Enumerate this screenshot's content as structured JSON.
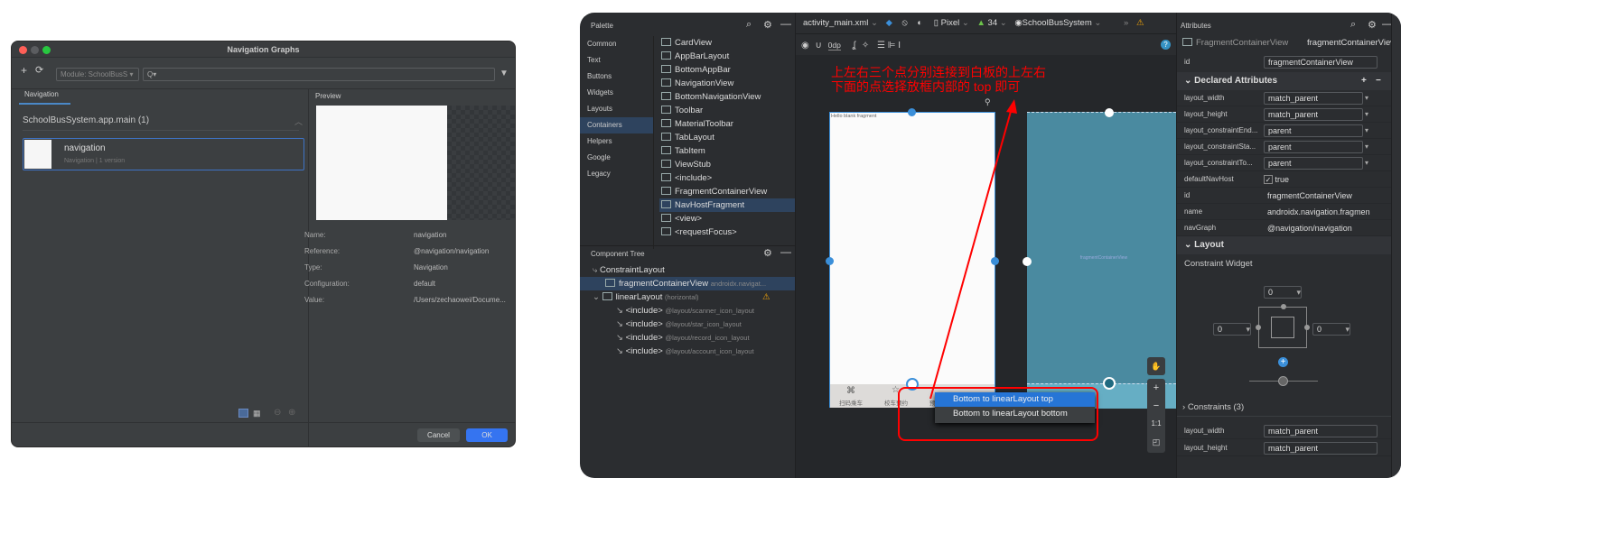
{
  "dialog": {
    "title": "Navigation Graphs",
    "module_select": "Module: SchoolBusS",
    "search_placeholder": "Q",
    "tab": "Navigation",
    "group": "SchoolBusSystem.app.main (1)",
    "item": {
      "name": "navigation",
      "meta": "Navigation  |  1 version"
    },
    "preview_label": "Preview",
    "details": [
      {
        "label": "Name:",
        "value": "navigation"
      },
      {
        "label": "Reference:",
        "value": "@navigation/navigation"
      },
      {
        "label": "Type:",
        "value": "Navigation"
      },
      {
        "label": "Configuration:",
        "value": "default"
      },
      {
        "label": "Value:",
        "value": "/Users/zechaowei/Docume..."
      }
    ],
    "cancel": "Cancel",
    "ok": "OK"
  },
  "ide": {
    "palette": {
      "title": "Palette",
      "categories": [
        "Common",
        "Text",
        "Buttons",
        "Widgets",
        "Layouts",
        "Containers",
        "Helpers",
        "Google",
        "Legacy"
      ],
      "selected_category": "Containers",
      "items": [
        "CardView",
        "AppBarLayout",
        "BottomAppBar",
        "NavigationView",
        "BottomNavigationView",
        "Toolbar",
        "MaterialToolbar",
        "TabLayout",
        "TabItem",
        "ViewStub",
        "<include>",
        "FragmentContainerView",
        "NavHostFragment",
        "<view>",
        "<requestFocus>"
      ],
      "selected_item": "NavHostFragment"
    },
    "toolbar": {
      "file": "activity_main.xml",
      "device": "Pixel",
      "api": "34",
      "theme": "SchoolBusSystem",
      "margin": "0dp"
    },
    "tree": {
      "title": "Component Tree",
      "rows": [
        {
          "name": "ConstraintLayout",
          "extra": ""
        },
        {
          "name": "fragmentContainerView",
          "extra": "androidx.navigat..."
        },
        {
          "name": "linearLayout",
          "extra": "(horizontal)"
        },
        {
          "name": "<include>",
          "extra": "@layout/scanner_icon_layout"
        },
        {
          "name": "<include>",
          "extra": "@layout/star_icon_layout"
        },
        {
          "name": "<include>",
          "extra": "@layout/record_icon_layout"
        },
        {
          "name": "<include>",
          "extra": "@layout/account_icon_layout"
        }
      ]
    },
    "annotation": {
      "line1": "上左右三个点分别连接到白板的上左右",
      "line2": "下面的点选择放框内部的 top 即可"
    },
    "design": {
      "hello": "Hello blank fragment",
      "tabs": [
        "扫码乘车",
        "校车预约",
        "预"
      ]
    },
    "blueprint": {
      "label": "fragmentContainerView"
    },
    "popup": {
      "items": [
        "Bottom to linearLayout top",
        "Bottom to linearLayout bottom"
      ],
      "selected": 0
    },
    "zoom": {
      "fit": "1:1"
    },
    "attributes": {
      "title": "Attributes",
      "class": "FragmentContainerView",
      "id_header": "fragmentContainerView",
      "id_label": "id",
      "id_value": "fragmentContainerView",
      "declared_title": "Declared Attributes",
      "declared": [
        {
          "k": "layout_width",
          "v": "match_parent"
        },
        {
          "k": "layout_height",
          "v": "match_parent"
        },
        {
          "k": "layout_constraintEnd...",
          "v": "parent"
        },
        {
          "k": "layout_constraintSta...",
          "v": "parent"
        },
        {
          "k": "layout_constraintTo...",
          "v": "parent"
        },
        {
          "k": "defaultNavHost",
          "v": "true"
        },
        {
          "k": "id",
          "v": "fragmentContainerView"
        },
        {
          "k": "name",
          "v": "androidx.navigation.fragmen"
        },
        {
          "k": "navGraph",
          "v": "@navigation/navigation"
        }
      ],
      "layout_title": "Layout",
      "constraint_widget": "Constraint Widget",
      "margins": {
        "top": "0",
        "left": "0",
        "right": "0"
      },
      "constraints": "Constraints (3)",
      "bottom_rows": [
        {
          "k": "layout_width",
          "v": "match_parent"
        },
        {
          "k": "layout_height",
          "v": "match_parent"
        }
      ]
    }
  },
  "colors": {
    "accent": "#3574f0",
    "annotation": "#ff0000",
    "blueprint": "#4a8aa0"
  }
}
